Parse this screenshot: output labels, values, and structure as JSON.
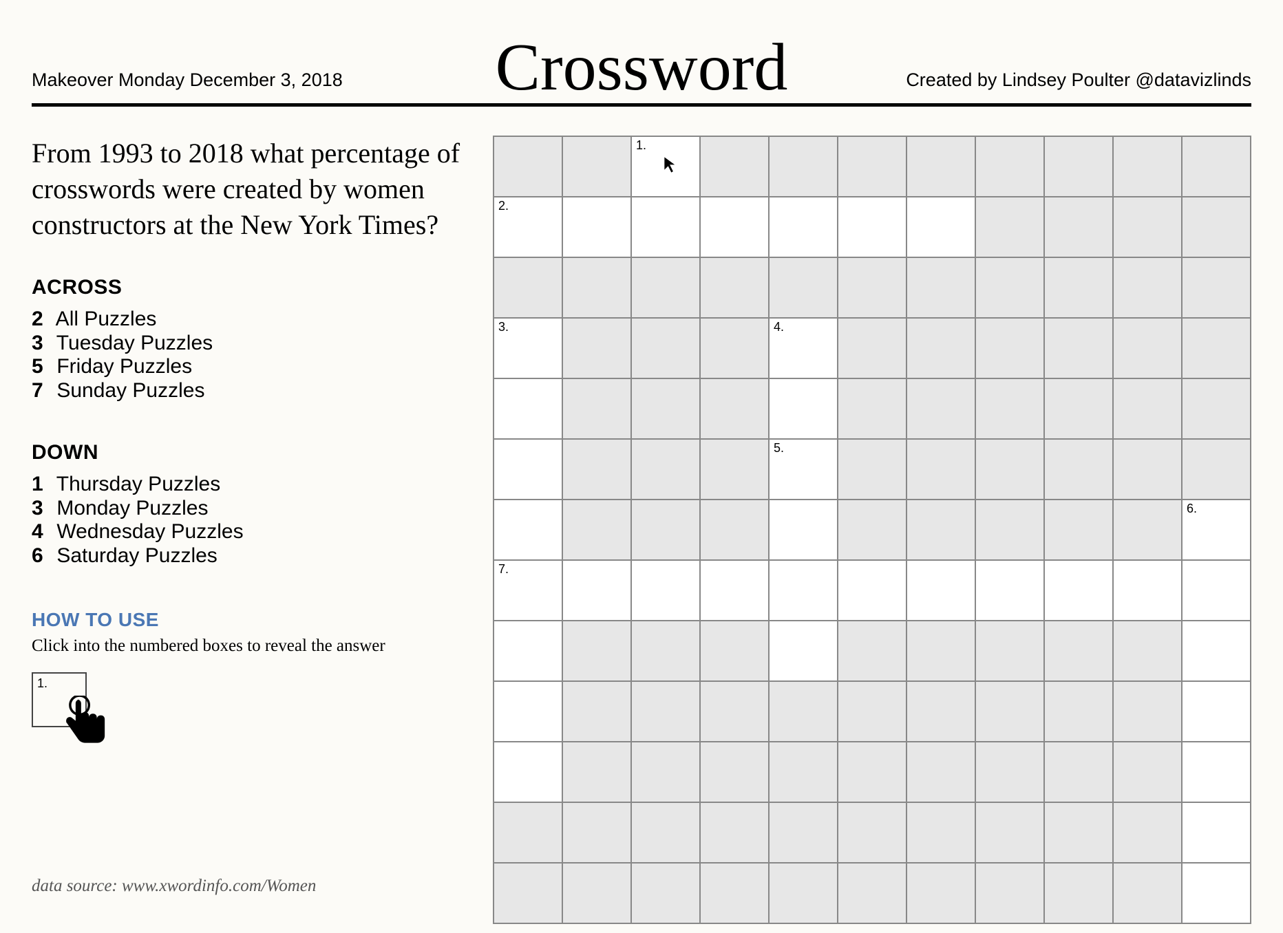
{
  "header": {
    "left": "Makeover Monday December 3, 2018",
    "title": "Crossword",
    "right": "Created by Lindsey Poulter @datavizlinds"
  },
  "question": "From 1993 to 2018 what percentage of crosswords were created by women constructors at the New York Times?",
  "across": {
    "heading": "ACROSS",
    "clues": [
      {
        "num": "2",
        "text": "All Puzzles"
      },
      {
        "num": "3",
        "text": "Tuesday Puzzles"
      },
      {
        "num": "5",
        "text": "Friday Puzzles"
      },
      {
        "num": "7",
        "text": "Sunday Puzzles"
      }
    ]
  },
  "down": {
    "heading": "DOWN",
    "clues": [
      {
        "num": "1",
        "text": "Thursday Puzzles"
      },
      {
        "num": "3",
        "text": "Monday Puzzles"
      },
      {
        "num": "4",
        "text": "Wednesday Puzzles"
      },
      {
        "num": "6",
        "text": "Saturday Puzzles"
      }
    ]
  },
  "howto": {
    "heading": "HOW TO USE",
    "text": "Click into the numbered boxes to reveal the answer",
    "demo_label": "1."
  },
  "source": "data source: www.xwordinfo.com/Women",
  "grid": {
    "rows": 13,
    "cols": 11,
    "white_cells": [
      [
        0,
        2
      ],
      [
        1,
        0
      ],
      [
        1,
        1
      ],
      [
        1,
        2
      ],
      [
        1,
        3
      ],
      [
        1,
        4
      ],
      [
        1,
        5
      ],
      [
        1,
        6
      ],
      [
        3,
        0
      ],
      [
        3,
        4
      ],
      [
        4,
        0
      ],
      [
        4,
        4
      ],
      [
        5,
        0
      ],
      [
        5,
        4
      ],
      [
        6,
        0
      ],
      [
        6,
        4
      ],
      [
        6,
        10
      ],
      [
        7,
        0
      ],
      [
        7,
        1
      ],
      [
        7,
        2
      ],
      [
        7,
        3
      ],
      [
        7,
        4
      ],
      [
        7,
        5
      ],
      [
        7,
        6
      ],
      [
        7,
        7
      ],
      [
        7,
        8
      ],
      [
        7,
        9
      ],
      [
        7,
        10
      ],
      [
        8,
        0
      ],
      [
        8,
        4
      ],
      [
        8,
        10
      ],
      [
        9,
        0
      ],
      [
        9,
        10
      ],
      [
        10,
        0
      ],
      [
        10,
        10
      ],
      [
        11,
        10
      ],
      [
        12,
        10
      ]
    ],
    "labels": {
      "0,2": "1.",
      "1,0": "2.",
      "3,0": "3.",
      "3,4": "4.",
      "5,4": "5.",
      "6,10": "6.",
      "7,0": "7."
    }
  }
}
